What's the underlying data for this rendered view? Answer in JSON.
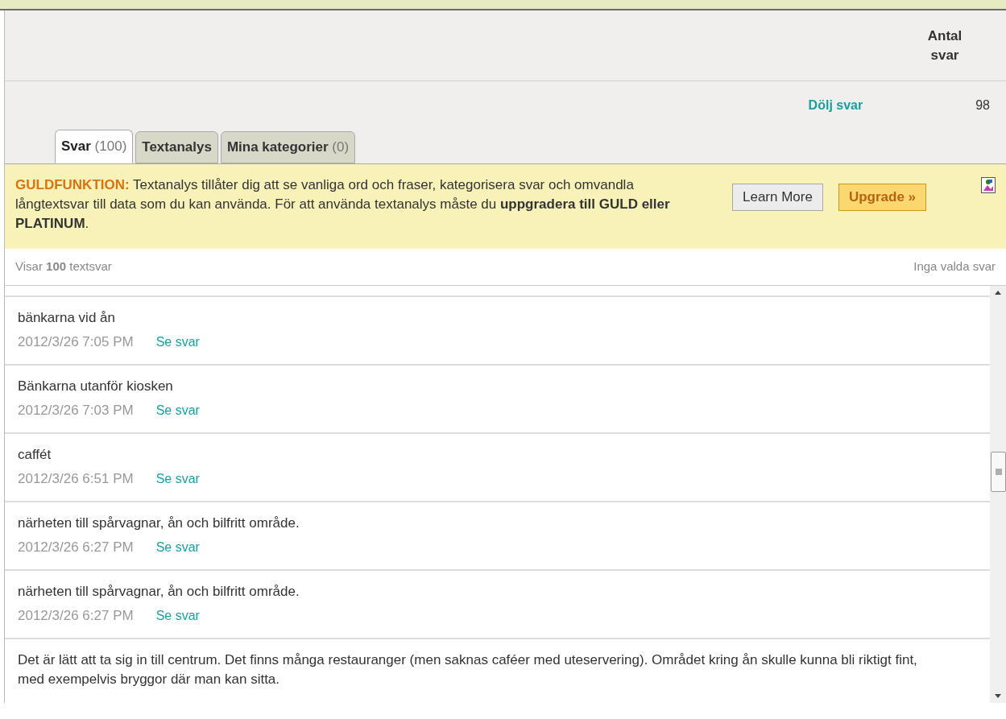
{
  "header": {
    "column": "Antal svar"
  },
  "summary": {
    "toggle_link": "Dölj svar",
    "count": "98"
  },
  "tabs": [
    {
      "label": "Svar",
      "count": "(100)",
      "selected": true
    },
    {
      "label": "Textanalys",
      "selected": false
    },
    {
      "label": "Mina kategorier",
      "count": "(0)",
      "selected": false
    }
  ],
  "banner": {
    "text": "**GULDFUNKTION:** Textanalys tillåter dig att se vanliga ord och fraser, kategorisera svar och omvandla långtextsvar till data som du kan använda. För att använda textanalys måste du **uppgradera till GULD eller PLATINUM**.",
    "buttons": [
      {
        "label": "Learn More",
        "kind": "plain"
      },
      {
        "label": "Upgrade »",
        "kind": "primary"
      }
    ]
  },
  "list_header": {
    "showing": "Visar **100** textsvar",
    "selection": "Inga valda svar"
  },
  "responses": [
    {
      "text": "bänkarna vid ån",
      "date": "2012/3/26 7:05 PM",
      "link": "Se svar"
    },
    {
      "text": "Bänkarna utanför kiosken",
      "date": "2012/3/26 7:03 PM",
      "link": "Se svar"
    },
    {
      "text": "caffét",
      "date": "2012/3/26 6:51 PM",
      "link": "Se svar"
    },
    {
      "text": "närheten till spårvagnar, ån och bilfritt område.",
      "date": "2012/3/26 6:27 PM",
      "link": "Se svar"
    },
    {
      "text": "närheten till spårvagnar, ån och bilfritt område.",
      "date": "2012/3/26 6:27 PM",
      "link": "Se svar"
    },
    {
      "text": "Det är lätt att ta sig in till centrum. Det finns många restauranger (men saknas caféer med uteservering). Området kring ån skulle kunna bli riktigt fint, med exempelvis bryggor där man kan sitta."
    }
  ]
}
